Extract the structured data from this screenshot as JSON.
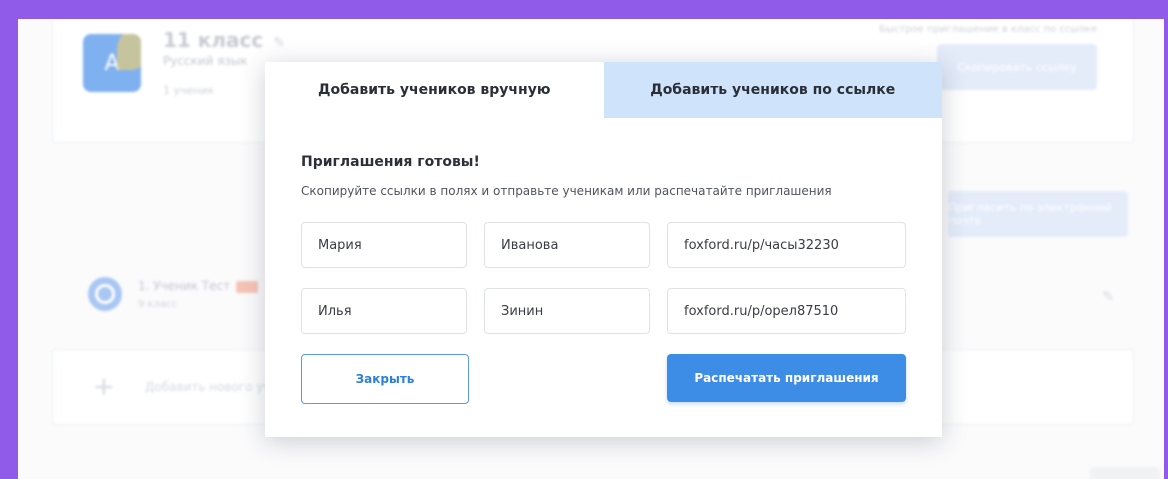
{
  "background": {
    "class_card": {
      "avatar_letter": "А",
      "title": "11 класс",
      "subject": "Русский язык",
      "students_count": "1 ученик",
      "quick_add_text": "Быстрое приглашение в класс по ссылке",
      "copy_link_label": "Скопировать ссылку"
    },
    "invite_button_label": "Пригласить по электронной почте",
    "student": {
      "name": "1. Ученик Тест",
      "class": "9 класс"
    },
    "add_student_label": "Добавить нового ученика"
  },
  "modal": {
    "tabs": [
      {
        "label": "Добавить учеников вручную",
        "active": true
      },
      {
        "label": "Добавить учеников по ссылке",
        "active": false
      }
    ],
    "title": "Приглашения готовы!",
    "description": "Скопируйте ссылки в полях и отправьте ученикам или распечатайте приглашения",
    "rows": [
      {
        "first_name": "Мария",
        "last_name": "Иванова",
        "link": "foxford.ru/p/часы32230"
      },
      {
        "first_name": "Илья",
        "last_name": "Зинин",
        "link": "foxford.ru/p/орел87510"
      }
    ],
    "close_label": "Закрыть",
    "print_label": "Распечатать приглашения"
  },
  "colors": {
    "frame": "#8f5be8",
    "accent": "#3d8de6",
    "inactive_tab": "#cfe3fb"
  }
}
